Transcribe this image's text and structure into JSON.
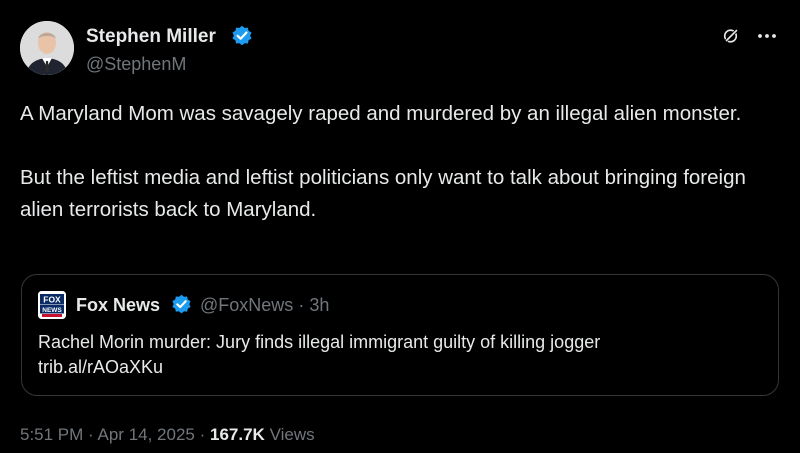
{
  "author": {
    "name": "Stephen Miller",
    "handle": "@StephenM",
    "verified_color": "#1d9bf0"
  },
  "actions": {
    "grok_icon": "grok-icon",
    "more_icon": "more-icon"
  },
  "tweet": {
    "paragraph_1": "A Maryland Mom was savagely raped and murdered by an illegal alien monster.",
    "paragraph_2": "But the leftist media and leftist politicians only want to talk about bringing foreign alien terrorists back to Maryland."
  },
  "quote": {
    "name": "Fox News",
    "handle": "@FoxNews",
    "separator": "·",
    "time": "3h",
    "headline": "Rachel Morin murder: Jury finds illegal immigrant guilty of killing jogger",
    "link": "trib.al/rAOaXKu",
    "logo_text": "FOX NEWS"
  },
  "meta": {
    "time": "5:51 PM",
    "date": "Apr 14, 2025",
    "separator": "·",
    "views_count": "167.7K",
    "views_label": "Views"
  }
}
